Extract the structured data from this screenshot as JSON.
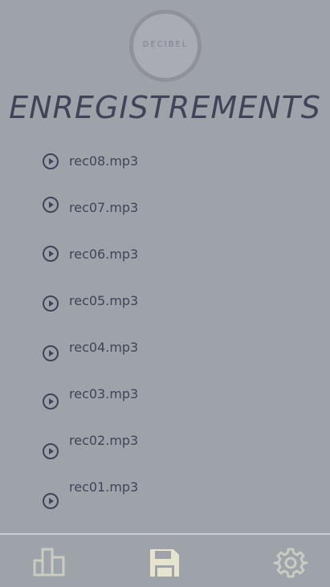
{
  "logo": {
    "text": "DECIBEL"
  },
  "title": "ENREGISTREMENTS",
  "recordings": [
    {
      "name": "rec08.mp3",
      "icon": "play-circle-icon"
    },
    {
      "name": "rec07.mp3",
      "icon": "play-circle-icon"
    },
    {
      "name": "rec06.mp3",
      "icon": "play-circle-icon"
    },
    {
      "name": "rec05.mp3",
      "icon": "play-circle-icon"
    },
    {
      "name": "rec04.mp3",
      "icon": "play-circle-icon"
    },
    {
      "name": "rec03.mp3",
      "icon": "play-circle-icon"
    },
    {
      "name": "rec02.mp3",
      "icon": "play-circle-icon"
    },
    {
      "name": "rec01.mp3",
      "icon": "play-circle-icon"
    }
  ],
  "nav": {
    "items": [
      {
        "icon": "bar-chart-icon",
        "active": false
      },
      {
        "icon": "save-icon",
        "active": true
      },
      {
        "icon": "gear-icon",
        "active": false
      }
    ]
  },
  "colors": {
    "background": "#9ea2a9",
    "text": "#3f4459",
    "nav_icon": "#c9ccc0",
    "nav_active": "#e6e4cf"
  }
}
